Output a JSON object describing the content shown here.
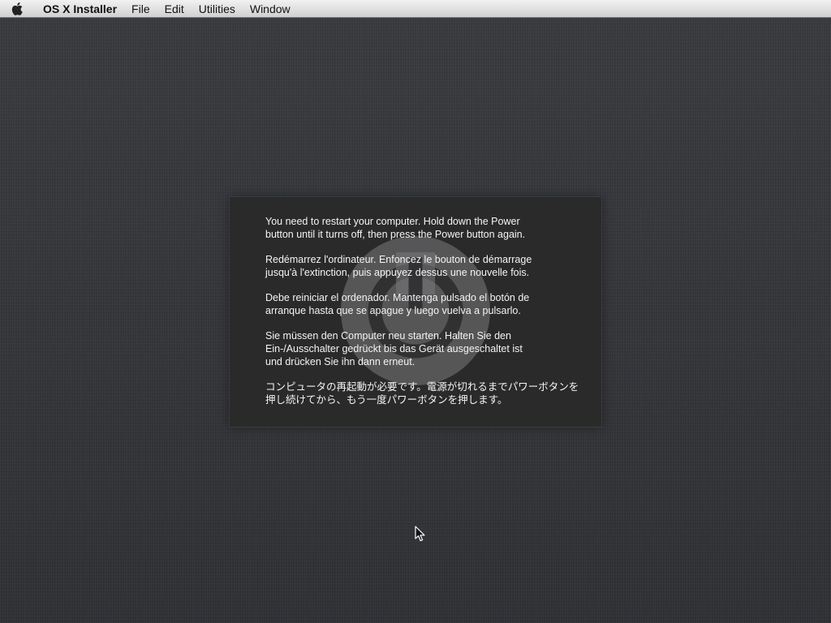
{
  "menubar": {
    "apple_icon": "apple-logo",
    "app_name": "OS X Installer",
    "items": [
      "File",
      "Edit",
      "Utilities",
      "Window"
    ]
  },
  "panel": {
    "icon": "power-icon",
    "messages": [
      "You need to restart your computer. Hold down the Power\nbutton until it turns off, then press the Power button again.",
      "Redémarrez l'ordinateur. Enfoncez le bouton de démarrage\njusqu'à l'extinction, puis appuyez dessus une nouvelle fois.",
      "Debe reiniciar el ordenador. Mantenga pulsado el botón de\narranque hasta que se apague y luego vuelva a pulsarlo.",
      "Sie müssen den Computer neu starten. Halten Sie den\nEin-/Ausschalter gedrückt bis das Gerät ausgeschaltet ist\nund drücken Sie ihn dann erneut.",
      "コンピュータの再起動が必要です。電源が切れるまでパワーボタンを\n押し続けてから、もう一度パワーボタンを押します。"
    ]
  },
  "cursor": "arrow-cursor"
}
